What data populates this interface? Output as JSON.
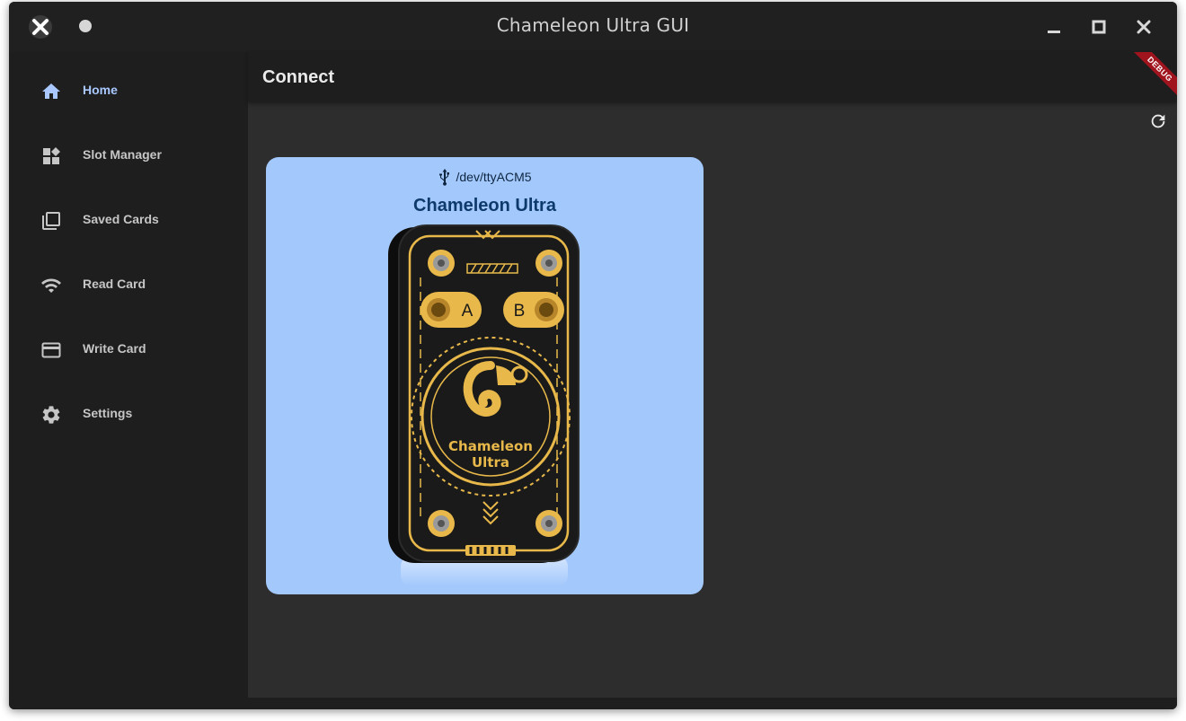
{
  "window": {
    "title": "Chameleon Ultra GUI",
    "controls": [
      "minimize-icon",
      "maximize-icon",
      "close-icon"
    ]
  },
  "sidebar": {
    "items": [
      {
        "label": "Home",
        "icon": "home-icon",
        "active": true
      },
      {
        "label": "Slot Manager",
        "icon": "dashboard-icon",
        "active": false
      },
      {
        "label": "Saved Cards",
        "icon": "library-icon",
        "active": false
      },
      {
        "label": "Read Card",
        "icon": "wifi-icon",
        "active": false
      },
      {
        "label": "Write Card",
        "icon": "credit-card-icon",
        "active": false
      },
      {
        "label": "Settings",
        "icon": "gear-icon",
        "active": false
      }
    ]
  },
  "main": {
    "heading": "Connect",
    "debug_banner": "DEBUG",
    "device_card": {
      "port": "/dev/ttyACM5",
      "device_name": "Chameleon Ultra",
      "button_a": "A",
      "button_b": "B",
      "logo_line1": "Chameleon",
      "logo_line2": "Ultra"
    }
  },
  "colors": {
    "accent": "#a8c8ff",
    "card_bg": "#a3c8fc",
    "device_gold": "#e8b94a",
    "debug_red": "#a0141e"
  }
}
